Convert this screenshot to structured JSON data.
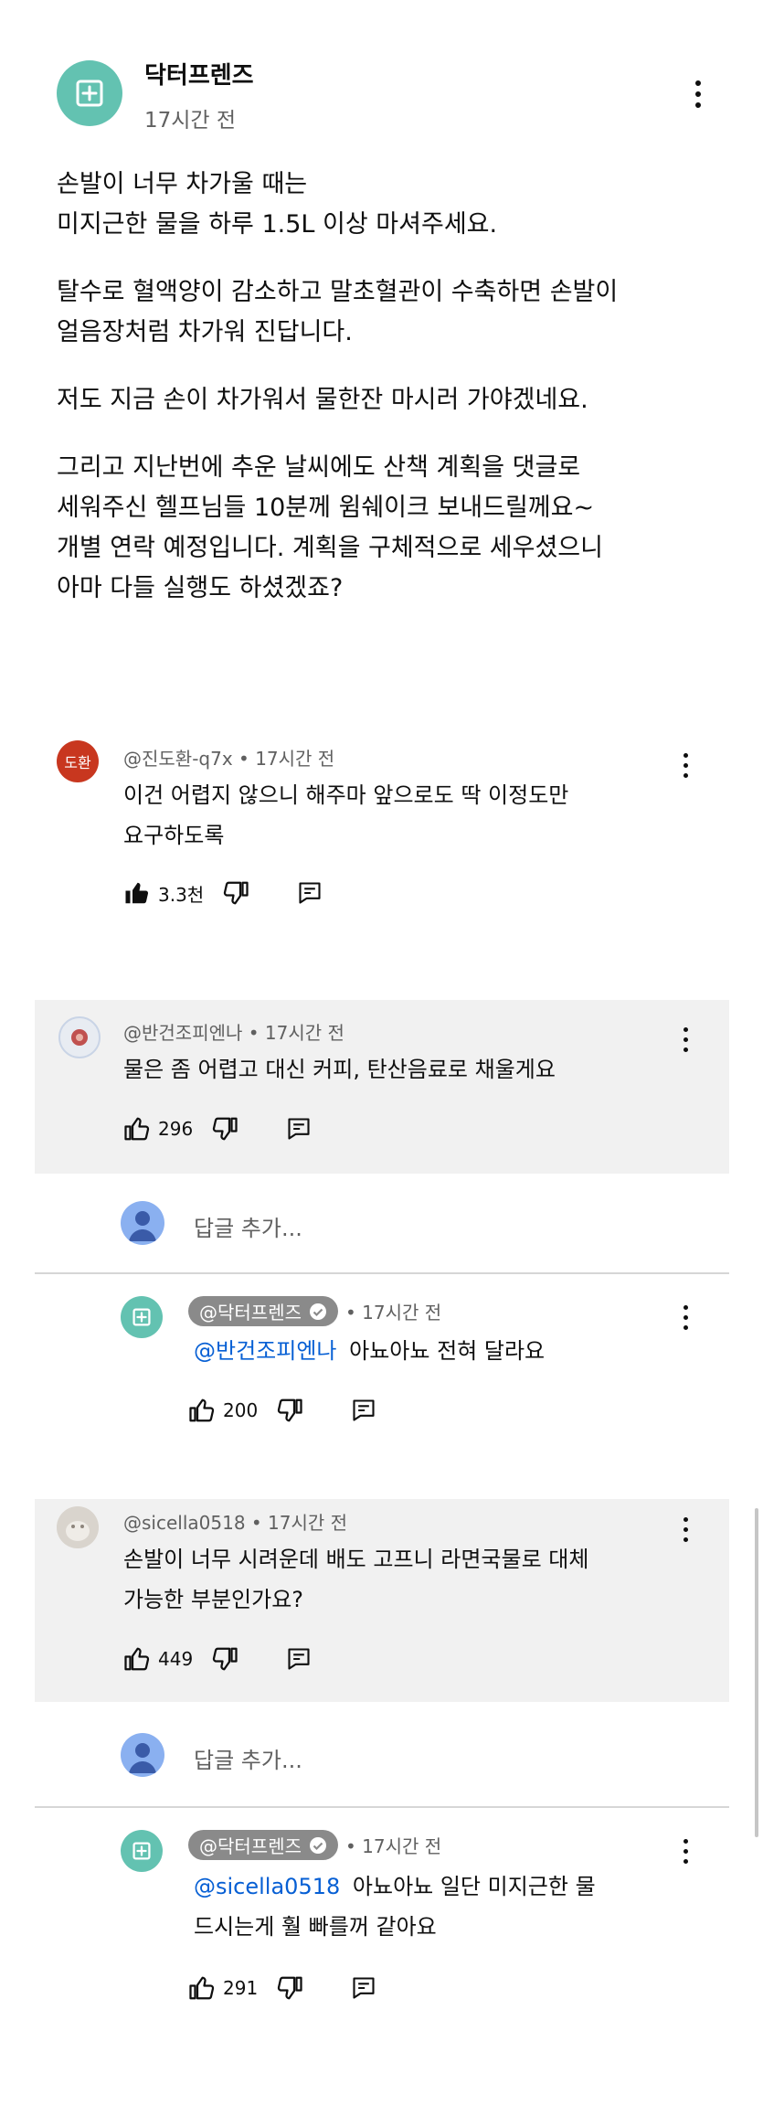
{
  "post": {
    "channel_name": "닥터프렌즈",
    "time": "17시간 전",
    "paragraphs": [
      [
        "손발이 너무 차가울 때는",
        "미지근한 물을 하루 1.5L 이상 마셔주세요."
      ],
      [
        "탈수로 혈액양이 감소하고 말초혈관이 수축하면 손발이",
        "얼음장처럼 차가워 진답니다."
      ],
      [
        "저도 지금 손이 차가워서 물한잔 마시러 가야겠네요."
      ],
      [
        "그리고 지난번에 추운 날씨에도 산책 계획을 댓글로",
        "세워주신 헬프님들 10분께 윔쉐이크 보내드릴께요~",
        "개별 연락 예정입니다. 계획을 구체적으로 세우셨으니",
        "아마 다들 실행도 하셨겠죠?"
      ]
    ]
  },
  "comments": [
    {
      "author": "@진도환-q7x",
      "time": "• 17시간 전",
      "avatar_text": "도환",
      "lines": [
        "이건 어렵지 않으니 해주마 앞으로도 딱 이정도만",
        "요구하도록"
      ],
      "likes": "3.3천"
    },
    {
      "author": "@반건조피엔나",
      "time": "• 17시간 전",
      "lines": [
        "물은 좀 어렵고 대신 커피, 탄산음료로 채울게요"
      ],
      "likes": "296",
      "add_reply": "답글 추가...",
      "reply": {
        "author": "@닥터프렌즈",
        "time": "• 17시간 전",
        "mention": "@반건조피엔나",
        "lines": [
          "아뇨아뇨 전혀 달라요"
        ],
        "likes": "200"
      }
    },
    {
      "author": "@sicella0518",
      "time": "• 17시간 전",
      "lines": [
        "손발이 너무 시려운데 배도 고프니 라면국물로 대체",
        "가능한 부분인가요?"
      ],
      "likes": "449",
      "add_reply": "답글 추가...",
      "reply": {
        "author": "@닥터프렌즈",
        "time": "• 17시간 전",
        "mention": "@sicella0518",
        "lines": [
          "아뇨아뇨 일단 미지근한 물",
          "드시는게 훨 빠를꺼 같아요"
        ],
        "likes": "291"
      }
    }
  ],
  "icons": {
    "channel_logo": "plus-square-icon",
    "menu": "more-vertical-icon",
    "like": "thumbs-up-icon",
    "dislike": "thumbs-down-icon",
    "reply": "reply-comment-icon",
    "verified": "check-circle-icon",
    "user_avatar": "person-icon"
  },
  "colors": {
    "brand": "#63c2b1",
    "mention": "#065fd4",
    "highlight_bg": "#f1f1f1",
    "avatar_red": "#c8371f",
    "user_avatar": "#8ab0f0"
  }
}
